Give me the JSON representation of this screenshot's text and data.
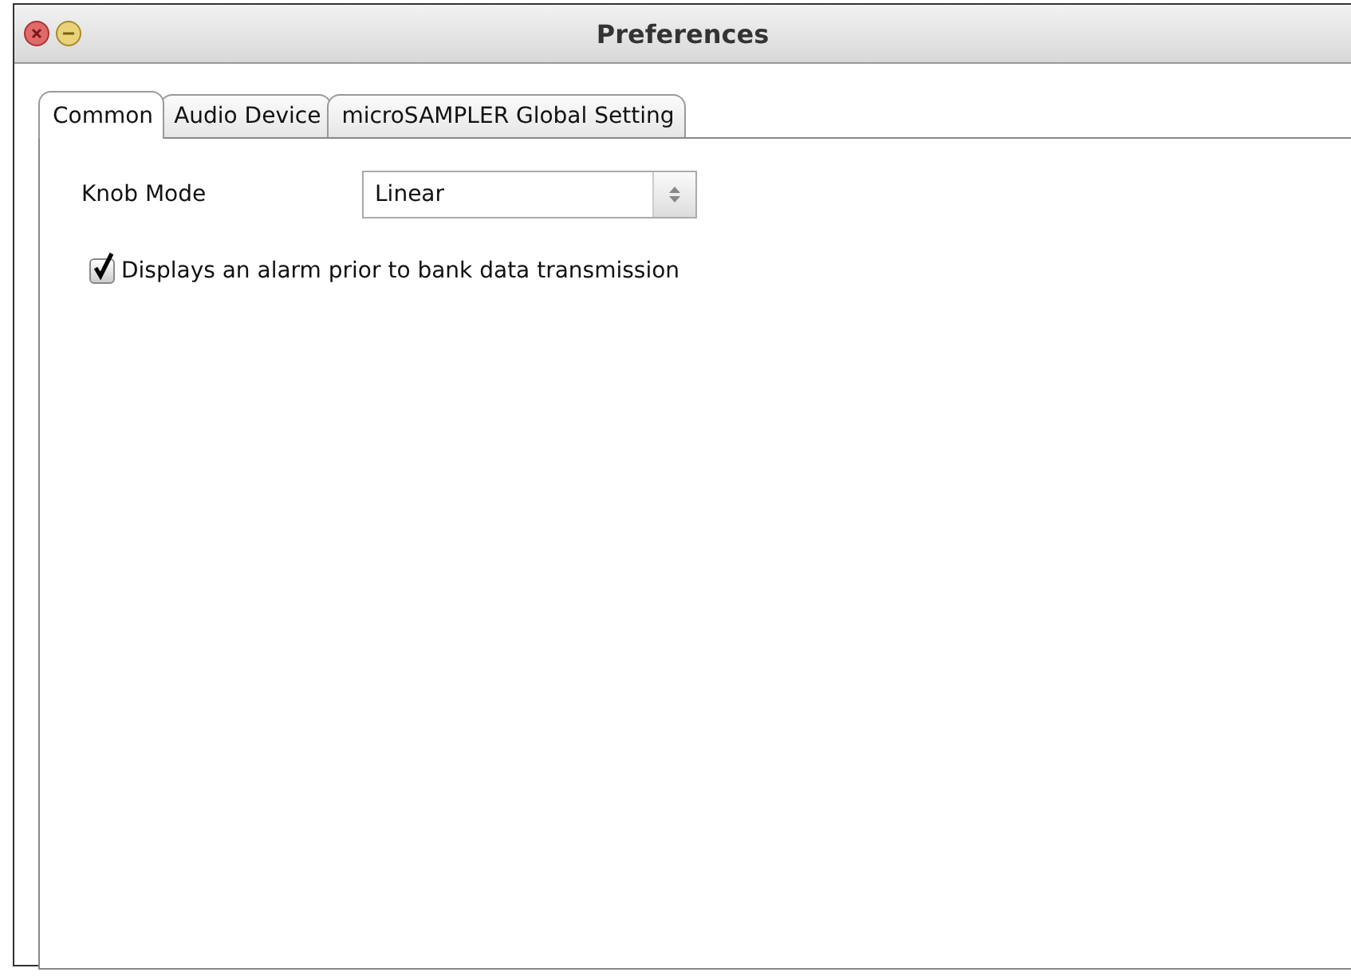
{
  "window": {
    "title": "Preferences"
  },
  "tabs": [
    {
      "label": "Common",
      "selected": true
    },
    {
      "label": "Audio Device",
      "selected": false
    },
    {
      "label": "microSAMPLER Global Setting",
      "selected": false
    }
  ],
  "knob_mode": {
    "label": "Knob Mode",
    "value": "Linear"
  },
  "alarm_option": {
    "label": "Displays an alarm prior to bank data transmission",
    "checked": true
  }
}
